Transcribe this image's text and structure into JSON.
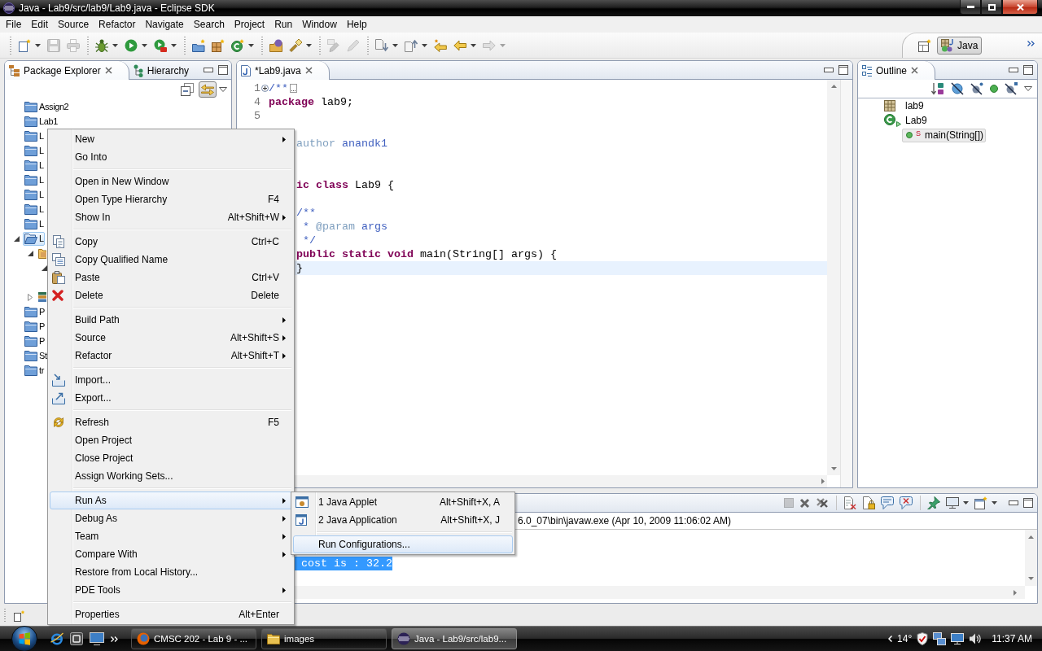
{
  "window": {
    "title": "Java - Lab9/src/lab9/Lab9.java - Eclipse SDK"
  },
  "menu_bar": [
    "File",
    "Edit",
    "Source",
    "Refactor",
    "Navigate",
    "Search",
    "Project",
    "Run",
    "Window",
    "Help"
  ],
  "toolbar": [
    {
      "kind": "new",
      "dropdown": true,
      "disabled": false
    },
    {
      "kind": "save",
      "dropdown": false,
      "disabled": true
    },
    {
      "kind": "print",
      "dropdown": false,
      "disabled": true
    },
    {
      "kind": "separator"
    },
    {
      "kind": "debug",
      "dropdown": true,
      "disabled": false
    },
    {
      "kind": "run",
      "dropdown": true,
      "disabled": false
    },
    {
      "kind": "external",
      "dropdown": true,
      "disabled": false
    },
    {
      "kind": "separator"
    },
    {
      "kind": "project",
      "dropdown": false,
      "disabled": false
    },
    {
      "kind": "package",
      "dropdown": false,
      "disabled": false
    },
    {
      "kind": "class",
      "dropdown": true,
      "disabled": false
    },
    {
      "kind": "separator"
    },
    {
      "kind": "opentype",
      "dropdown": false,
      "disabled": false
    },
    {
      "kind": "search",
      "dropdown": true,
      "disabled": false
    },
    {
      "kind": "separator"
    },
    {
      "kind": "occurrences",
      "dropdown": false,
      "disabled": true
    },
    {
      "kind": "pen",
      "dropdown": false,
      "disabled": true
    },
    {
      "kind": "separator"
    },
    {
      "kind": "nextannotation",
      "dropdown": true,
      "disabled": false
    },
    {
      "kind": "prevannotation",
      "dropdown": true,
      "disabled": false
    },
    {
      "kind": "lastedit",
      "dropdown": false,
      "disabled": false
    },
    {
      "kind": "back",
      "dropdown": true,
      "disabled": false
    },
    {
      "kind": "forward",
      "dropdown": true,
      "disabled": true
    }
  ],
  "perspectives": [
    {
      "label": "Java",
      "selected": true
    }
  ],
  "package_explorer": {
    "tabs": [
      {
        "kind": "packages",
        "label": "Package Explorer",
        "selected": true
      },
      {
        "kind": "hierarchy",
        "label": "Hierarchy",
        "selected": false
      }
    ],
    "toolbar": [
      {
        "kind": "collapse",
        "on": false
      },
      {
        "kind": "link",
        "on": true
      }
    ],
    "tree": [
      {
        "kind": "project",
        "label": "Assign2",
        "selected": false
      },
      {
        "kind": "project",
        "label": "Lab1",
        "selected": false
      },
      {
        "kind": "project",
        "label": "L",
        "selected": false
      },
      {
        "kind": "project",
        "label": "L",
        "selected": false
      },
      {
        "kind": "project",
        "label": "L",
        "selected": false
      },
      {
        "kind": "project",
        "label": "L",
        "selected": false
      },
      {
        "kind": "project",
        "label": "L",
        "selected": false
      },
      {
        "kind": "project",
        "label": "L",
        "selected": false
      },
      {
        "kind": "project",
        "label": "L",
        "selected": false
      },
      {
        "kind": "project",
        "label": "L",
        "selected": true,
        "expanded": true,
        "children": [
          {
            "kind": "source",
            "selected": false,
            "expanded": true,
            "children": [
              {
                "expanded": true
              }
            ]
          },
          {
            "kind": "library",
            "selected": false,
            "expanded": false
          }
        ]
      },
      {
        "kind": "project",
        "label": "P",
        "selected": false
      },
      {
        "kind": "project",
        "label": "P",
        "selected": false
      },
      {
        "kind": "project",
        "label": "P",
        "selected": false
      },
      {
        "kind": "project",
        "label": "St",
        "selected": false
      },
      {
        "kind": "project",
        "label": "tr",
        "selected": false
      }
    ]
  },
  "editor": {
    "tabs": [
      {
        "kind": "java",
        "label": "*Lab9.java",
        "selected": true
      }
    ],
    "lines": [
      {
        "kind": "numbered",
        "number": "1",
        "folded": true,
        "current": false,
        "code": [
          {
            "kind": "comment",
            "text": "/**"
          }
        ]
      },
      {
        "kind": "numbered",
        "number": "4",
        "current": false,
        "code": [
          {
            "kind": "keyword",
            "text": "package"
          },
          {
            "kind": "plain",
            "text": " lab9;"
          }
        ]
      },
      {
        "kind": "numbered",
        "number": "5",
        "current": false
      },
      {
        "kind": "blank"
      },
      {
        "kind": "covered",
        "current": false,
        "code": [
          {
            "kind": "tag",
            "text": "author"
          },
          {
            "kind": "comment",
            "text": " anandk1"
          }
        ]
      },
      {
        "kind": "blank"
      },
      {
        "kind": "blank"
      },
      {
        "kind": "covered",
        "current": false,
        "code": [
          {
            "kind": "keyword",
            "text": "ic class"
          },
          {
            "kind": "plain",
            "text": " Lab9 {"
          }
        ]
      },
      {
        "kind": "blank"
      },
      {
        "kind": "covered",
        "current": false,
        "code": [
          {
            "kind": "comment",
            "text": "/**"
          }
        ]
      },
      {
        "kind": "covered",
        "current": false,
        "code": [
          {
            "kind": "comment",
            "text": " * "
          },
          {
            "kind": "tag",
            "text": "@param"
          },
          {
            "kind": "comment",
            "text": " args"
          }
        ]
      },
      {
        "kind": "covered",
        "current": false,
        "code": [
          {
            "kind": "comment",
            "text": " */"
          }
        ]
      },
      {
        "kind": "covered",
        "current": false,
        "code": [
          {
            "kind": "keyword",
            "text": "public static void"
          },
          {
            "kind": "plain",
            "text": " main(String[] args) {"
          }
        ]
      },
      {
        "kind": "covered",
        "current": true,
        "code": [
          {
            "kind": "plain",
            "text": "}"
          }
        ]
      }
    ]
  },
  "outline": {
    "tabs": [
      {
        "kind": "outline",
        "label": "Outline",
        "selected": true
      }
    ],
    "tree": [
      {
        "kind": "package",
        "label": "lab9",
        "selected": false
      },
      {
        "kind": "class",
        "label": "Lab9",
        "selected": false,
        "children": [
          {
            "kind": "method",
            "label": "main(String[])",
            "badge": "S",
            "selected": true
          }
        ]
      }
    ]
  },
  "console": {
    "toolbar": [
      {
        "kind": "terminate",
        "dropdown": false,
        "disabled": true
      },
      {
        "kind": "remove",
        "dropdown": false,
        "disabled": false
      },
      {
        "kind": "removeall",
        "dropdown": false,
        "disabled": false
      },
      {
        "kind": "separator"
      },
      {
        "kind": "clear",
        "dropdown": false,
        "disabled": false
      },
      {
        "kind": "scrolllock",
        "dropdown": false,
        "disabled": false
      },
      {
        "kind": "stdout",
        "dropdown": false,
        "disabled": false
      },
      {
        "kind": "stderr",
        "dropdown": false,
        "disabled": false
      },
      {
        "kind": "separator"
      },
      {
        "kind": "pin",
        "dropdown": false,
        "disabled": false
      },
      {
        "kind": "display",
        "dropdown": true,
        "disabled": false
      },
      {
        "kind": "open",
        "dropdown": true,
        "disabled": false
      }
    ],
    "description": "6.0_07\\bin\\javaw.exe (Apr 10, 2009 11:06:02 AM)",
    "output": [
      {
        "text": "cost is : 32.2",
        "selected": true
      }
    ]
  },
  "context_menu": {
    "items": [
      {
        "kind": "plain",
        "label": "New",
        "submenu": true,
        "selected": false
      },
      {
        "kind": "plain",
        "label": "Go Into",
        "submenu": false,
        "selected": false
      },
      {
        "kind": "separator"
      },
      {
        "kind": "plain",
        "label": "Open in New Window",
        "submenu": false,
        "selected": false
      },
      {
        "kind": "plain",
        "label": "Open Type Hierarchy",
        "shortcut": "F4",
        "submenu": false,
        "selected": false
      },
      {
        "kind": "plain",
        "label": "Show In",
        "shortcut": "Alt+Shift+W",
        "submenu": true,
        "selected": false
      },
      {
        "kind": "separator"
      },
      {
        "kind": "copy",
        "label": "Copy",
        "shortcut": "Ctrl+C",
        "submenu": false,
        "selected": false
      },
      {
        "kind": "qualified",
        "label": "Copy Qualified Name",
        "submenu": false,
        "selected": false
      },
      {
        "kind": "paste",
        "label": "Paste",
        "shortcut": "Ctrl+V",
        "submenu": false,
        "selected": false
      },
      {
        "kind": "delete",
        "label": "Delete",
        "shortcut": "Delete",
        "submenu": false,
        "selected": false
      },
      {
        "kind": "separator"
      },
      {
        "kind": "plain",
        "label": "Build Path",
        "submenu": true,
        "selected": false
      },
      {
        "kind": "plain",
        "label": "Source",
        "shortcut": "Alt+Shift+S",
        "submenu": true,
        "selected": false
      },
      {
        "kind": "plain",
        "label": "Refactor",
        "shortcut": "Alt+Shift+T",
        "submenu": true,
        "selected": false
      },
      {
        "kind": "separator"
      },
      {
        "kind": "import",
        "label": "Import...",
        "submenu": false,
        "selected": false
      },
      {
        "kind": "export",
        "label": "Export...",
        "submenu": false,
        "selected": false
      },
      {
        "kind": "separator"
      },
      {
        "kind": "refresh",
        "label": "Refresh",
        "shortcut": "F5",
        "submenu": false,
        "selected": false
      },
      {
        "kind": "plain",
        "label": "Open Project",
        "submenu": false,
        "selected": false
      },
      {
        "kind": "plain",
        "label": "Close Project",
        "submenu": false,
        "selected": false
      },
      {
        "kind": "plain",
        "label": "Assign Working Sets...",
        "submenu": false,
        "selected": false
      },
      {
        "kind": "separator"
      },
      {
        "kind": "plain",
        "label": "Run As",
        "submenu": true,
        "selected": true
      },
      {
        "kind": "plain",
        "label": "Debug As",
        "submenu": true,
        "selected": false
      },
      {
        "kind": "plain",
        "label": "Team",
        "submenu": true,
        "selected": false
      },
      {
        "kind": "plain",
        "label": "Compare With",
        "submenu": true,
        "selected": false
      },
      {
        "kind": "plain",
        "label": "Restore from Local History...",
        "submenu": false,
        "selected": false
      },
      {
        "kind": "plain",
        "label": "PDE Tools",
        "submenu": true,
        "selected": false
      },
      {
        "kind": "separator"
      },
      {
        "kind": "plain",
        "label": "Properties",
        "shortcut": "Alt+Enter",
        "submenu": false,
        "selected": false
      }
    ]
  },
  "submenu": {
    "items": [
      {
        "kind": "applet",
        "label": "1 Java Applet",
        "shortcut": "Alt+Shift+X, A",
        "submenu": false,
        "selected": false
      },
      {
        "kind": "application",
        "label": "2 Java Application",
        "shortcut": "Alt+Shift+X, J",
        "submenu": false,
        "selected": false
      },
      {
        "kind": "separator"
      },
      {
        "kind": "plain",
        "label": "Run Configurations...",
        "submenu": false,
        "selected": true
      }
    ]
  },
  "taskbar": {
    "tasks": [
      {
        "kind": "browser",
        "label": "CMSC 202 - Lab 9 - ...",
        "selected": false
      },
      {
        "kind": "folder",
        "label": "images",
        "selected": false
      },
      {
        "kind": "ide",
        "label": "Java - Lab9/src/lab9...",
        "selected": true
      }
    ],
    "temperature": "14°",
    "clock": "11:37 AM"
  }
}
